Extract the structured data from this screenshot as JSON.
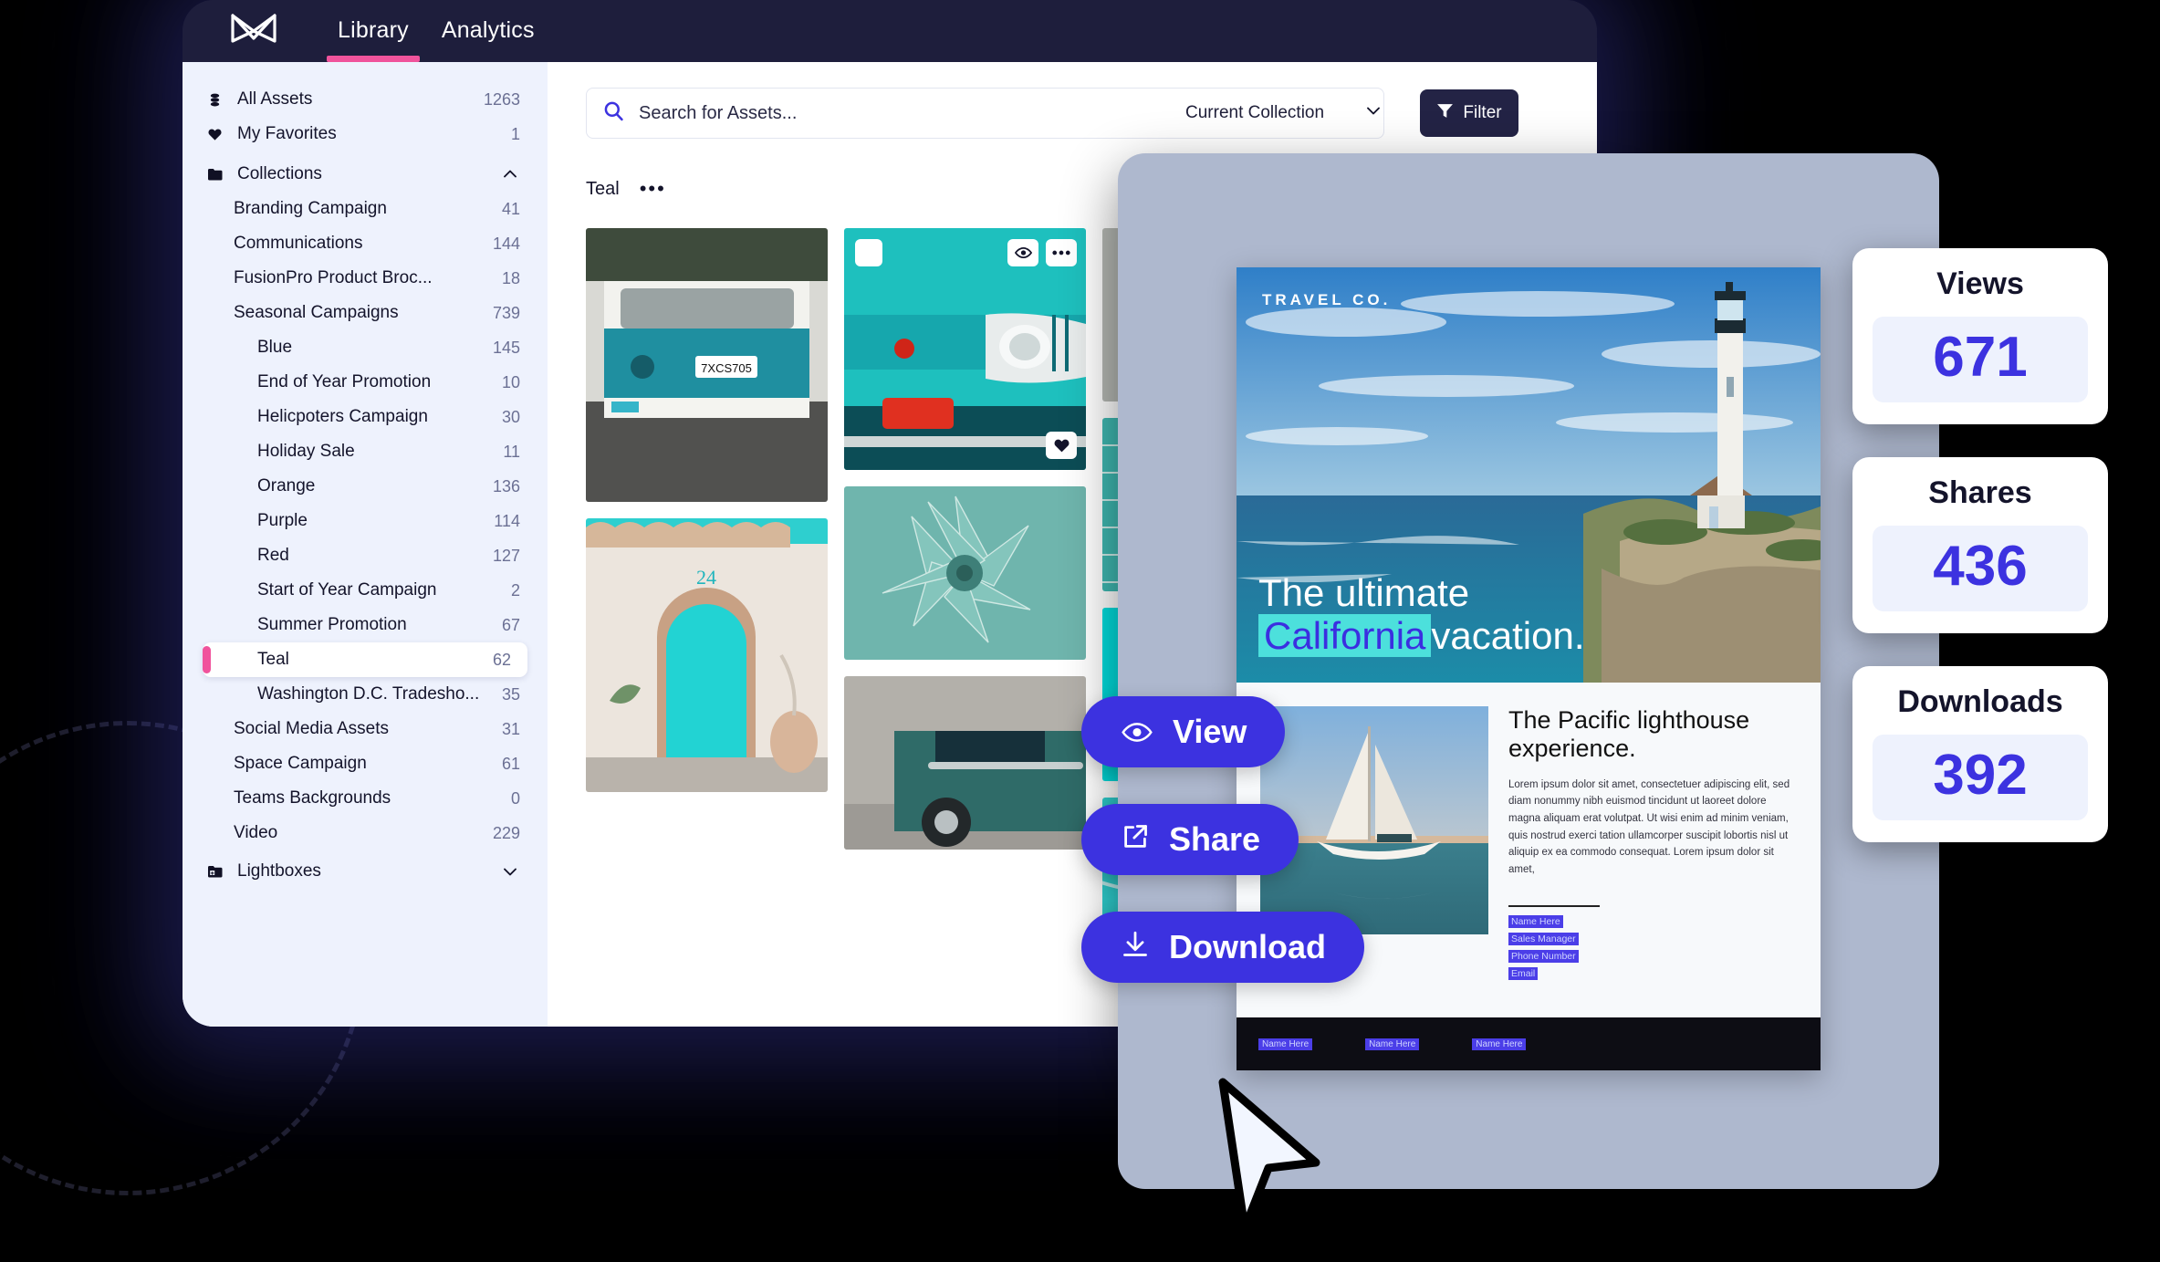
{
  "app": {
    "logo_icon": "butterfly-logo-icon",
    "nav_tabs": [
      {
        "label": "Library",
        "active": true
      },
      {
        "label": "Analytics",
        "active": false
      }
    ],
    "accent_pink": "#f0539c",
    "accent_blue": "#3c32e0",
    "window_bg": "#1e1e3c"
  },
  "sidebar": {
    "top_items": [
      {
        "label": "All Assets",
        "count": "1263",
        "icon": "stack-icon"
      },
      {
        "label": "My Favorites",
        "count": "1",
        "icon": "heart-icon"
      }
    ],
    "collections_header": {
      "label": "Collections",
      "icon": "folder-icon",
      "chevron": "chevron-up-icon"
    },
    "collections": [
      {
        "label": "Branding Campaign",
        "count": "41",
        "level": 1,
        "selected": false
      },
      {
        "label": "Communications",
        "count": "144",
        "level": 1,
        "selected": false
      },
      {
        "label": "FusionPro Product Broc...",
        "count": "18",
        "level": 1,
        "selected": false
      },
      {
        "label": "Seasonal Campaigns",
        "count": "739",
        "level": 1,
        "selected": false
      },
      {
        "label": "Blue",
        "count": "145",
        "level": 2,
        "selected": false
      },
      {
        "label": "End of Year Promotion",
        "count": "10",
        "level": 2,
        "selected": false
      },
      {
        "label": "Helicpoters Campaign",
        "count": "30",
        "level": 2,
        "selected": false
      },
      {
        "label": "Holiday Sale",
        "count": "11",
        "level": 2,
        "selected": false
      },
      {
        "label": "Orange",
        "count": "136",
        "level": 2,
        "selected": false
      },
      {
        "label": "Purple",
        "count": "114",
        "level": 2,
        "selected": false
      },
      {
        "label": "Red",
        "count": "127",
        "level": 2,
        "selected": false
      },
      {
        "label": "Start of Year Campaign",
        "count": "2",
        "level": 2,
        "selected": false
      },
      {
        "label": "Summer Promotion",
        "count": "67",
        "level": 2,
        "selected": false
      },
      {
        "label": "Teal",
        "count": "62",
        "level": 2,
        "selected": true
      },
      {
        "label": "Washington D.C. Tradesho...",
        "count": "35",
        "level": 2,
        "selected": false
      },
      {
        "label": "Social Media Assets",
        "count": "31",
        "level": 1,
        "selected": false
      },
      {
        "label": "Space Campaign",
        "count": "61",
        "level": 1,
        "selected": false
      },
      {
        "label": "Teams Backgrounds",
        "count": "0",
        "level": 1,
        "selected": false
      },
      {
        "label": "Video",
        "count": "229",
        "level": 1,
        "selected": false
      }
    ],
    "lightboxes_header": {
      "label": "Lightboxes",
      "icon": "folder-add-icon",
      "chevron": "chevron-down-icon"
    }
  },
  "toolbar": {
    "search_placeholder": "Search for Assets...",
    "search_value": "",
    "search_icon": "search-icon",
    "collection_scope": "Current Collection",
    "collection_chevron": "chevron-down-icon",
    "filter_label": "Filter",
    "filter_icon": "funnel-icon"
  },
  "collection_view": {
    "title": "Teal",
    "options_icon": "ellipsis-icon",
    "thumbnail_overlay": {
      "checkbox": "checkbox-icon",
      "preview_icon": "eye-icon",
      "menu_icon": "ellipsis-icon",
      "favorite_icon": "heart-icon"
    },
    "assets": [
      {
        "name": "teal-vw-bus",
        "caption": "7XCS705"
      },
      {
        "name": "teal-door-24",
        "caption": "24"
      },
      {
        "name": "teal-car-front",
        "caption": ""
      },
      {
        "name": "agave-succulent",
        "caption": ""
      },
      {
        "name": "teal-vintage-car",
        "caption": ""
      },
      {
        "name": "glass-water-rings",
        "caption": ""
      },
      {
        "name": "teal-knit-fabric",
        "caption": ""
      },
      {
        "name": "cyan-graphic",
        "caption": ""
      },
      {
        "name": "pool-water",
        "caption": ""
      }
    ]
  },
  "preview": {
    "brochure": {
      "brand": "TRAVEL CO.",
      "headline_pre": "The ultimate",
      "headline_mark": "California",
      "headline_post": "vacation.",
      "subhead": "The Pacific lighthouse experience.",
      "body": "Lorem ipsum dolor sit amet, consectetuer adipiscing elit, sed diam nonummy nibh euismod tincidunt ut laoreet dolore magna aliquam erat volutpat. Ut wisi enim ad minim veniam, quis nostrud exerci tation ullamcorper suscipit lobortis nisl ut aliquip ex ea commodo consequat. Lorem ipsum dolor sit amet,",
      "contact": [
        "Name Here",
        "Sales Manager",
        "Phone Number",
        "Email"
      ],
      "footer_name": "Name Here",
      "hero_image": "pacific-lighthouse-cliff",
      "lower_image": "sailboat-ocean"
    },
    "actions": [
      {
        "label": "View",
        "icon": "eye-icon"
      },
      {
        "label": "Share",
        "icon": "external-link-icon"
      },
      {
        "label": "Download",
        "icon": "download-icon"
      }
    ],
    "cursor_icon": "mouse-pointer-icon"
  },
  "stats": [
    {
      "label": "Views",
      "value": "671"
    },
    {
      "label": "Shares",
      "value": "436"
    },
    {
      "label": "Downloads",
      "value": "392"
    }
  ]
}
